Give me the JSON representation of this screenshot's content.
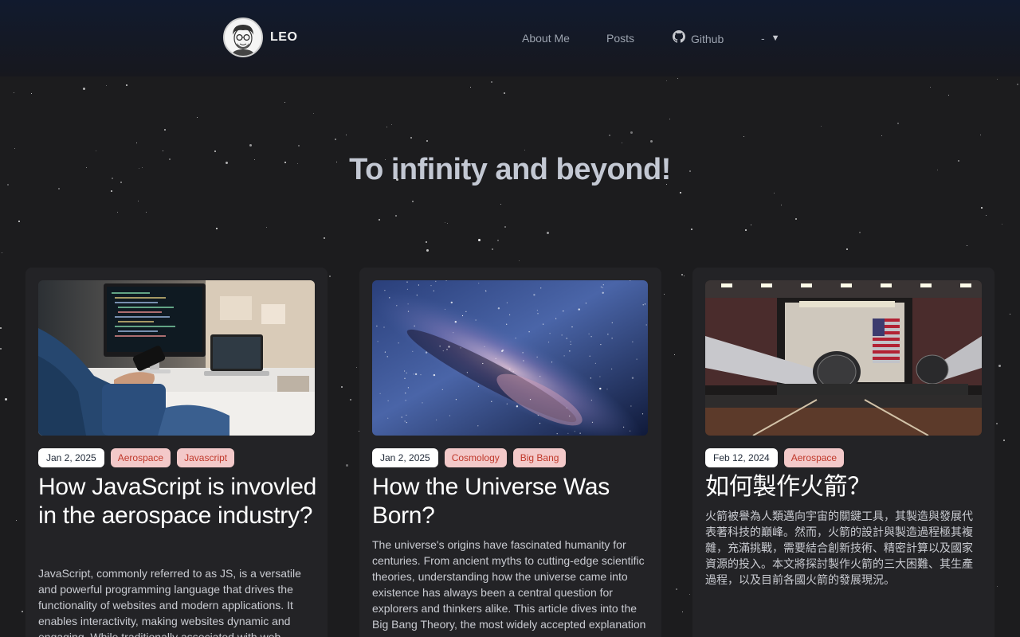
{
  "header": {
    "brand": "LEO",
    "nav": {
      "about": "About Me",
      "posts": "Posts",
      "github": "Github",
      "language": "-"
    }
  },
  "hero": {
    "title": "To infinity and beyond!"
  },
  "posts": [
    {
      "date": "Jan 2, 2025",
      "tags": [
        "Aerospace",
        "Javascript"
      ],
      "title": "How JavaScript is invovled in the aerospace industry?",
      "excerpt": "JavaScript, commonly referred to as JS, is a versatile and powerful programming language that drives the functionality of websites and modern applications. It enables interactivity, making websites dynamic and engaging. While traditionally associated with web",
      "image": "developer-desk-photo"
    },
    {
      "date": "Jan 2, 2025",
      "tags": [
        "Cosmology",
        "Big Bang"
      ],
      "title": "How the Universe Was Born?",
      "excerpt": "The universe's origins have fascinated humanity for centuries. From ancient myths to cutting-edge scientific theories, understanding how the universe came into existence has always been a central question for explorers and thinkers alike. This article dives into the Big Bang Theory, the most widely accepted explanation",
      "image": "milky-way-photo"
    },
    {
      "date": "Feb 12, 2024",
      "tags": [
        "Aerospace"
      ],
      "title": "如何製作火箭？",
      "excerpt": "火箭被譽為人類邁向宇宙的關鍵工具，其製造與發展代表著科技的巔峰。然而，火箭的設計與製造過程極其複雜，充滿挑戰，需要結合創新技術、精密計算以及國家資源的投入。本文將探討製作火箭的三大困難、其生產過程，以及目前各國火箭的發展現況。",
      "image": "rocket-hangar-photo"
    }
  ],
  "colors": {
    "background": "#1c1c1e",
    "card": "#232326",
    "tag_bg": "#f3c9c9",
    "tag_text": "#c0392b"
  }
}
